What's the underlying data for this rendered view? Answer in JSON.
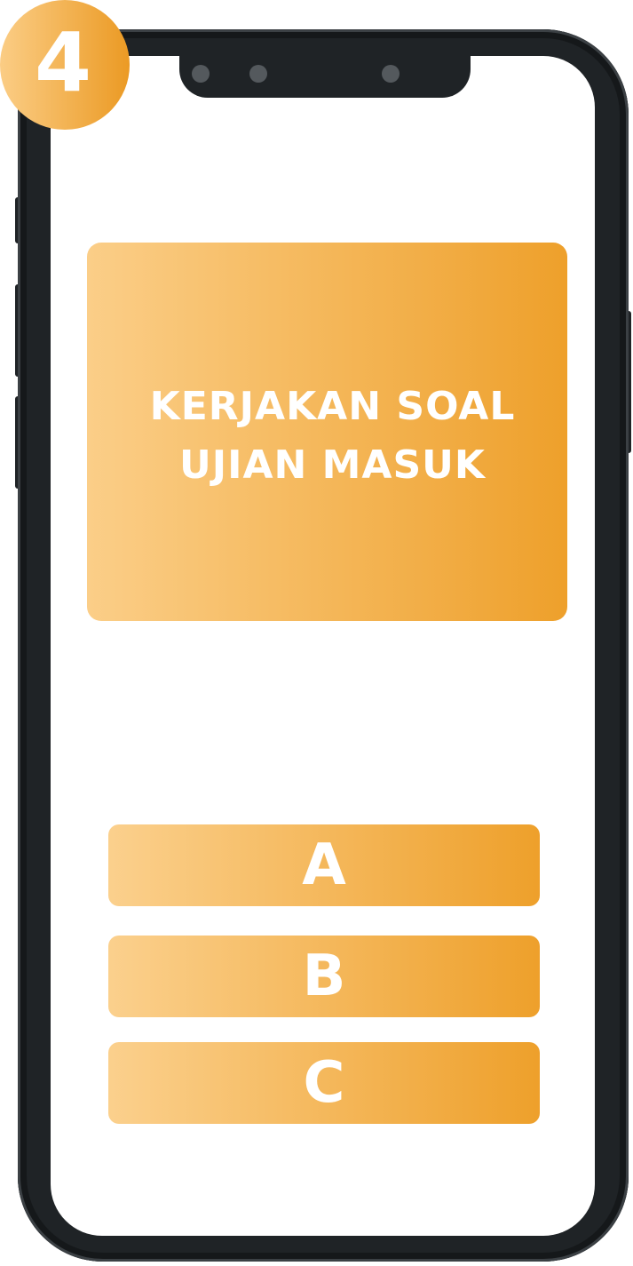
{
  "step": {
    "number": "4"
  },
  "question": {
    "title": "KERJAKAN SOAL\nUJIAN MASUK"
  },
  "options": [
    {
      "label": "A"
    },
    {
      "label": "B"
    },
    {
      "label": "C"
    }
  ],
  "colors": {
    "accent_light": "#fbcd85",
    "accent_dark": "#eb9a24",
    "phone_frame": "#1f2326",
    "screen": "#ffffff"
  }
}
